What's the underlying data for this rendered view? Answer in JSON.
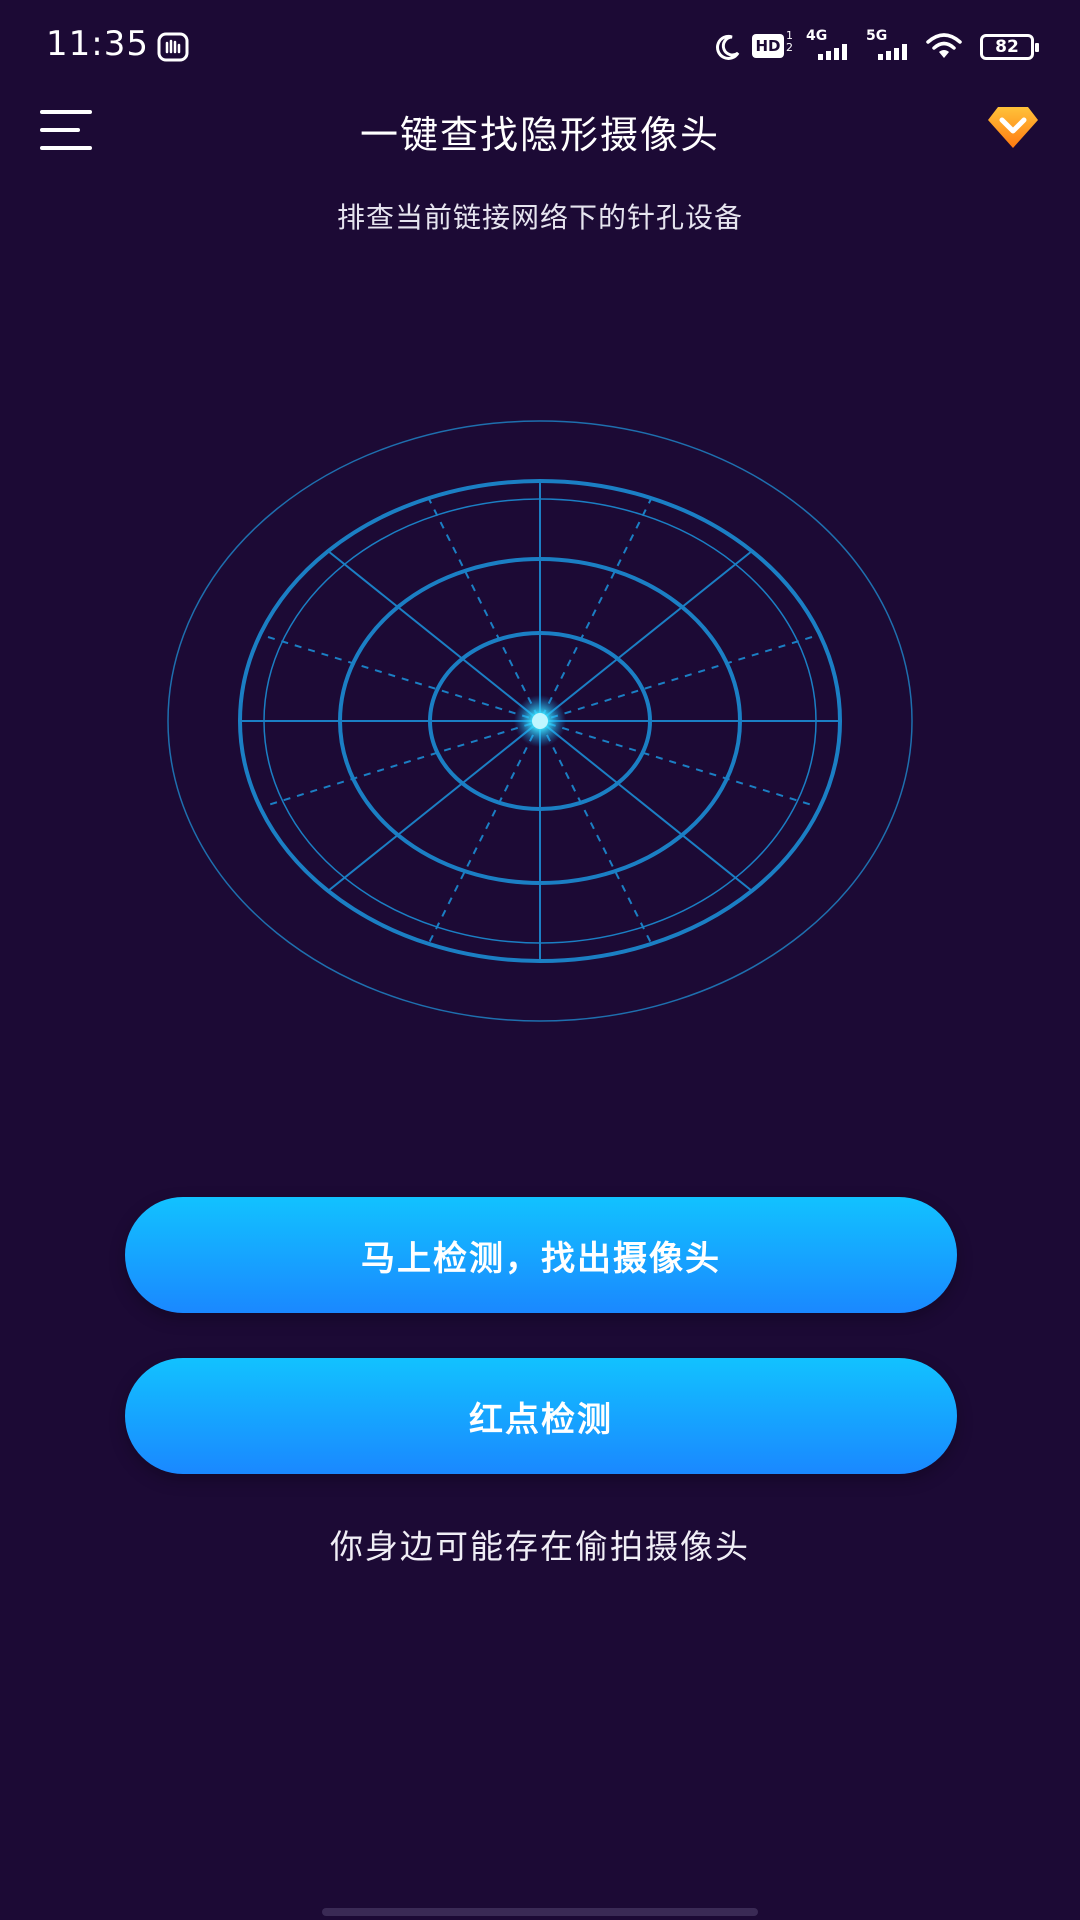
{
  "status_bar": {
    "time": "11:35",
    "battery": "82",
    "network_4g": "4G",
    "network_5g": "5G",
    "hd_label": "HD"
  },
  "header": {
    "title": "一键查找隐形摄像头",
    "menu_icon": "hamburger-icon",
    "vip_icon": "vip-diamond-icon"
  },
  "subtitle": "排查当前链接网络下的针孔设备",
  "actions": {
    "detect_label": "马上检测，找出摄像头",
    "red_dot_label": "红点检测"
  },
  "warning_text": "你身边可能存在偷拍摄像头",
  "colors": {
    "background": "#1c0a35",
    "radar_line": "#1b7fc4",
    "button_top": "#12c2ff",
    "button_bottom": "#1a88ff",
    "vip_orange": "#ff9a1f"
  }
}
